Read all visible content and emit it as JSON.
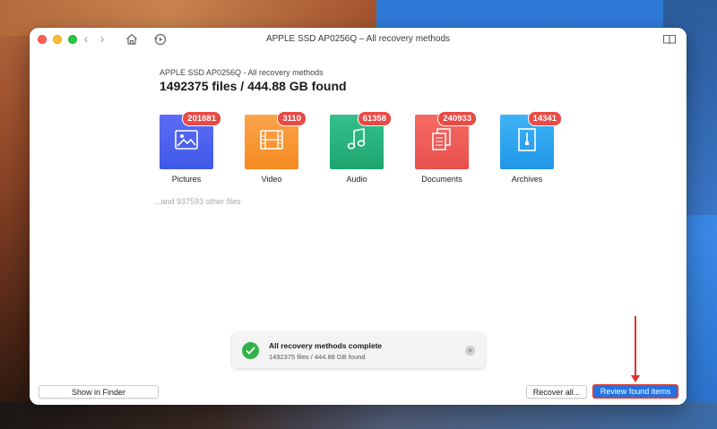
{
  "window": {
    "title": "APPLE SSD AP0256Q – All recovery methods",
    "nav_back": "‹",
    "nav_forward": "›",
    "icons": {
      "home": "home-icon",
      "recovery": "recovery-icon",
      "sidebar": "sidebar-book-icon"
    }
  },
  "header": {
    "subtitle": "APPLE SSD AP0256Q - All recovery methods",
    "summary": "1492375 files / 444.88 GB found"
  },
  "categories": [
    {
      "label": "Pictures",
      "count": "201881",
      "color_top": "#5b6cf5",
      "color_bottom": "#3f59e8",
      "icon": "pictures-icon"
    },
    {
      "label": "Video",
      "count": "3110",
      "color_top": "#fba44a",
      "color_bottom": "#f58a22",
      "icon": "video-film-icon"
    },
    {
      "label": "Audio",
      "count": "61358",
      "color_top": "#34c08c",
      "color_bottom": "#1ea56f",
      "icon": "music-note-icon"
    },
    {
      "label": "Documents",
      "count": "240933",
      "color_top": "#f56b63",
      "color_bottom": "#e8504c",
      "icon": "documents-icon"
    },
    {
      "label": "Archives",
      "count": "14341",
      "color_top": "#3fb3f6",
      "color_bottom": "#2196e8",
      "icon": "archive-icon"
    }
  ],
  "other_files": "...and 937593 other files",
  "toast": {
    "title": "All recovery methods complete",
    "subtitle": "1492375 files / 444.88 GB found",
    "close": "×"
  },
  "buttons": {
    "show_in_finder": "Show in Finder",
    "recover_all": "Recover all...",
    "review_found_items": "Review found items"
  },
  "colors": {
    "accent": "#1f73e6",
    "highlight": "#e53a2a",
    "badge": "#e84b46",
    "success": "#32b34a"
  }
}
